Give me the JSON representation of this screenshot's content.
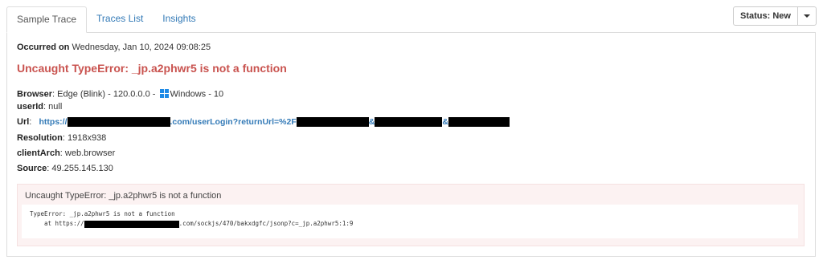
{
  "tabs": [
    {
      "label": "Sample Trace",
      "active": true
    },
    {
      "label": "Traces List",
      "active": false
    },
    {
      "label": "Insights",
      "active": false
    }
  ],
  "status": {
    "label": "Status: New"
  },
  "occurred": {
    "label": "Occurred on",
    "value": "Wednesday, Jan 10, 2024 09:08:25"
  },
  "error_title": "Uncaught TypeError: _jp.a2phwr5 is not a function",
  "info": {
    "browser": {
      "label": "Browser",
      "value": "Edge (Blink) - 120.0.0.0 -",
      "os": "Windows - 10",
      "os_icon": "windows-icon"
    },
    "userid": {
      "label": "userId",
      "value": "null"
    },
    "url": {
      "label": "Url",
      "prefix": "https://",
      "part1": ".com/userLogin?returnUrl=%2F",
      "part2": "&",
      "part3": "&"
    },
    "resolution": {
      "label": "Resolution",
      "value": "1918x938"
    },
    "clientarch": {
      "label": "clientArch",
      "value": "web.browser"
    },
    "source": {
      "label": "Source",
      "value": "49.255.145.130"
    }
  },
  "error_box": {
    "title": "Uncaught TypeError: _jp.a2phwr5 is not a function",
    "stack_line1": "TypeError: _jp.a2phwr5 is not a function",
    "stack_line2_prefix": "at https://",
    "stack_line2_suffix": ".com/sockjs/470/bakxdgfc/jsonp?c=_jp.a2phwr5:1:9"
  },
  "colors": {
    "error_red": "#c9534f",
    "link_blue": "#337ab7",
    "error_bg": "#fcf2f2"
  }
}
